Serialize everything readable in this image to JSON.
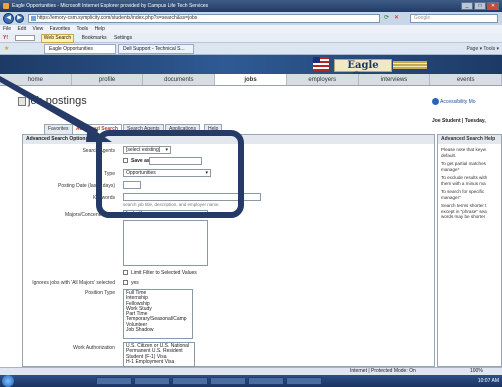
{
  "window": {
    "title": "Eagle Opportunities - Microsoft Internet Explorer provided by Campus Life Tech Services",
    "buttons": [
      "_",
      "□",
      "✕"
    ]
  },
  "address": {
    "url": "https://emory-csm.symplicity.com/students/index.php?s=search&ss=jobs",
    "search_placeholder": "Google"
  },
  "menu": [
    "File",
    "Edit",
    "View",
    "Favorites",
    "Tools",
    "Help"
  ],
  "toolbar": {
    "web_search": "Web Search",
    "bookmarks": "Bookmarks",
    "settings": "Settings"
  },
  "tabs": [
    {
      "label": "Eagle Opportunities"
    },
    {
      "label": "Dell Support - Technical S..."
    }
  ],
  "right_tools": "Page ▾  Tools ▾",
  "site": {
    "logo_text": "Eagle Ops",
    "nav": [
      "home",
      "profile",
      "documents",
      "jobs",
      "employers",
      "interviews",
      "events"
    ],
    "current_nav": "jobs"
  },
  "page": {
    "title": "job postings",
    "accessibility": "Accessibility Mo",
    "user": "Joe Student | Tuesday,"
  },
  "subtabs": [
    "Favorites",
    "Advanced Search",
    "Search Agents",
    "Applications",
    "Help"
  ],
  "current_subtab": "Advanced Search",
  "form": {
    "header": "Advanced Search Options",
    "saved_search_label": "Search Agents",
    "saved_search_value": "[select existing]",
    "save_as_label": "Save as:",
    "type_label": "Type",
    "type_value": "Opportunities",
    "posting_date_label": "Posting Date (last x days)",
    "keywords_label": "Keywords",
    "keywords_hint": "search job title, description, and employer name.",
    "majors_label": "Majors/Concentrations",
    "majors_value": "[select]",
    "limit_filter_label": "Limit Filter to Selected Values",
    "ignore_label": "Ignores jobs with 'All Majors' selected",
    "ignore_value": "yes",
    "position_type_label": "Position Type",
    "position_types": [
      "Full Time",
      "Internship",
      "Fellowship",
      "Work Study",
      "Part Time",
      "Temporary/Seasonal/Camp",
      "Volunteer",
      "Job Shadow"
    ],
    "work_auth_label": "Work Authorization",
    "work_auth": [
      "U.S. Citizen or U.S. National",
      "Permanent U.S. Resident",
      "Student (F-1) Visa",
      "H-1 Employment Visa"
    ]
  },
  "help": {
    "header": "Advanced Search Help",
    "p1": "Please note that keyw default.",
    "p2": "To get partial matches manage*",
    "p3": "To exclude results with them with a minus ma",
    "p4": "To search for specific manager\"",
    "p5": "Search terms shorter t except in \"phrase\" sea words may be shorter"
  },
  "status": {
    "zone": "Internet | Protected Mode: On",
    "zoom": "100%"
  },
  "taskbar": {
    "items": [
      "",
      "",
      "",
      "",
      "",
      ""
    ],
    "clock": "10:07 AM"
  }
}
